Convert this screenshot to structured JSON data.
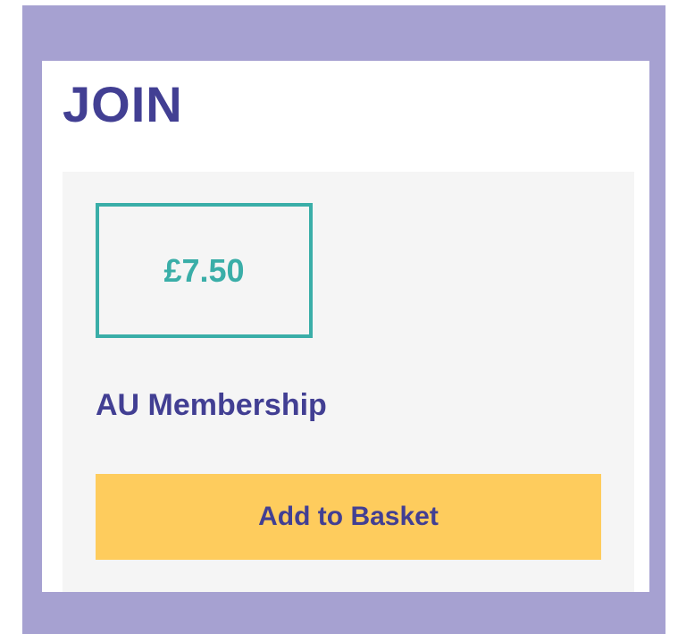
{
  "section": {
    "title": "JOIN"
  },
  "product": {
    "price": "£7.50",
    "name": "AU Membership",
    "add_label": "Add to Basket"
  },
  "colors": {
    "frame": "#a6a1d1",
    "heading": "#423f93",
    "price_accent": "#3aaea8",
    "card_background": "#f5f5f5",
    "button_background": "#fecc5d"
  }
}
